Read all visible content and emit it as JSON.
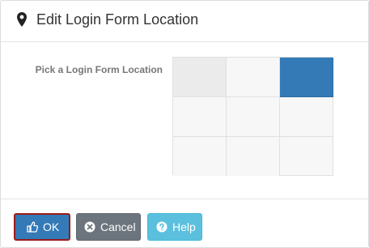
{
  "dialog": {
    "title": "Edit Login Form Location",
    "icon": "map-marker-icon"
  },
  "location_picker": {
    "label": "Pick a Login Form Location",
    "selected_cell": "top-right"
  },
  "buttons": {
    "ok": {
      "label": "OK",
      "icon": "thumbs-up-icon"
    },
    "cancel": {
      "label": "Cancel",
      "icon": "times-circle-icon"
    },
    "help": {
      "label": "Help",
      "icon": "question-circle-icon"
    }
  },
  "colors": {
    "primary": "#337ab7",
    "secondary": "#6c757d",
    "info": "#5bc0de",
    "focus_outline": "#9b1c1c"
  }
}
